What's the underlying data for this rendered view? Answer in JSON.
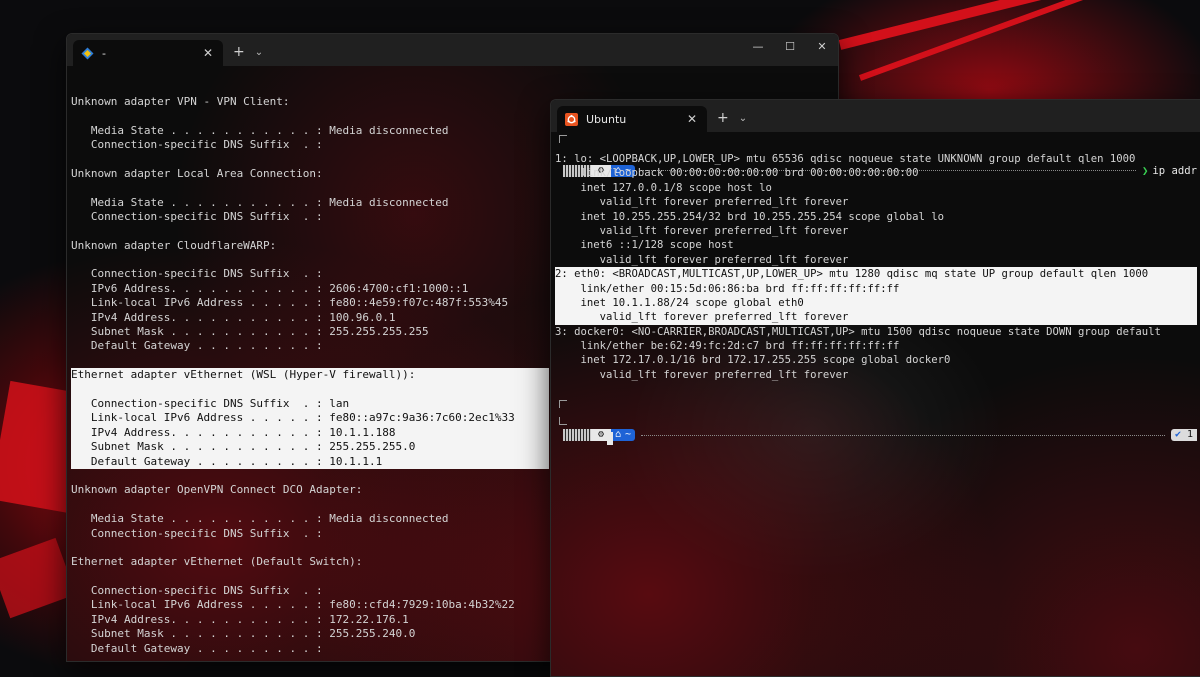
{
  "colors": {
    "accent_blue": "#1e63d6",
    "wallpaper_red": "#d3101a",
    "term_bg": "#0c0c0c"
  },
  "win1": {
    "tab": {
      "title": "-",
      "icon": "powershell-icon"
    },
    "lines": [
      "",
      "",
      "Unknown adapter VPN - VPN Client:",
      "",
      "   Media State . . . . . . . . . . . : Media disconnected",
      "   Connection-specific DNS Suffix  . :",
      "",
      "Unknown adapter Local Area Connection:",
      "",
      "   Media State . . . . . . . . . . . : Media disconnected",
      "   Connection-specific DNS Suffix  . :",
      "",
      "Unknown adapter CloudflareWARP:",
      "",
      "   Connection-specific DNS Suffix  . :",
      "   IPv6 Address. . . . . . . . . . . : 2606:4700:cf1:1000::1",
      "   Link-local IPv6 Address . . . . . : fe80::4e59:f07c:487f:553%45",
      "   IPv4 Address. . . . . . . . . . . : 100.96.0.1",
      "   Subnet Mask . . . . . . . . . . . : 255.255.255.255",
      "   Default Gateway . . . . . . . . . :",
      "",
      "Ethernet adapter vEthernet (WSL (Hyper-V firewall)):",
      "",
      "   Connection-specific DNS Suffix  . : lan",
      "   Link-local IPv6 Address . . . . . : fe80::a97c:9a36:7c60:2ec1%33",
      "   IPv4 Address. . . . . . . . . . . : 10.1.1.188",
      "   Subnet Mask . . . . . . . . . . . : 255.255.255.0",
      "   Default Gateway . . . . . . . . . : 10.1.1.1",
      "",
      "Unknown adapter OpenVPN Connect DCO Adapter:",
      "",
      "   Media State . . . . . . . . . . . : Media disconnected",
      "   Connection-specific DNS Suffix  . :",
      "",
      "Ethernet adapter vEthernet (Default Switch):",
      "",
      "   Connection-specific DNS Suffix  . :",
      "   Link-local IPv6 Address . . . . . : fe80::cfd4:7929:10ba:4b32%22",
      "   IPv4 Address. . . . . . . . . . . : 172.22.176.1",
      "   Subnet Mask . . . . . . . . . . . : 255.255.240.0",
      "   Default Gateway . . . . . . . . . :"
    ]
  },
  "win2": {
    "tab": {
      "title": "Ubuntu",
      "icon": "ubuntu-icon"
    },
    "prompt": {
      "os_icon": "linux-icon",
      "dir": "~",
      "arrow": "❯",
      "command": "ip addr",
      "status_count": "1"
    },
    "lines": [
      "1: lo: <LOOPBACK,UP,LOWER_UP> mtu 65536 qdisc noqueue state UNKNOWN group default qlen 1000",
      "    link/loopback 00:00:00:00:00:00 brd 00:00:00:00:00:00",
      "    inet 127.0.0.1/8 scope host lo",
      "       valid_lft forever preferred_lft forever",
      "    inet 10.255.255.254/32 brd 10.255.255.254 scope global lo",
      "       valid_lft forever preferred_lft forever",
      "    inet6 ::1/128 scope host",
      "       valid_lft forever preferred_lft forever",
      "2: eth0: <BROADCAST,MULTICAST,UP,LOWER_UP> mtu 1280 qdisc mq state UP group default qlen 1000",
      "    link/ether 00:15:5d:06:86:ba brd ff:ff:ff:ff:ff:ff",
      "    inet 10.1.1.88/24 scope global eth0",
      "       valid_lft forever preferred_lft forever",
      "3: docker0: <NO-CARRIER,BROADCAST,MULTICAST,UP> mtu 1500 qdisc noqueue state DOWN group default",
      "    link/ether be:62:49:fc:2d:c7 brd ff:ff:ff:ff:ff:ff",
      "    inet 172.17.0.1/16 brd 172.17.255.255 scope global docker0",
      "       valid_lft forever preferred_lft forever"
    ]
  }
}
